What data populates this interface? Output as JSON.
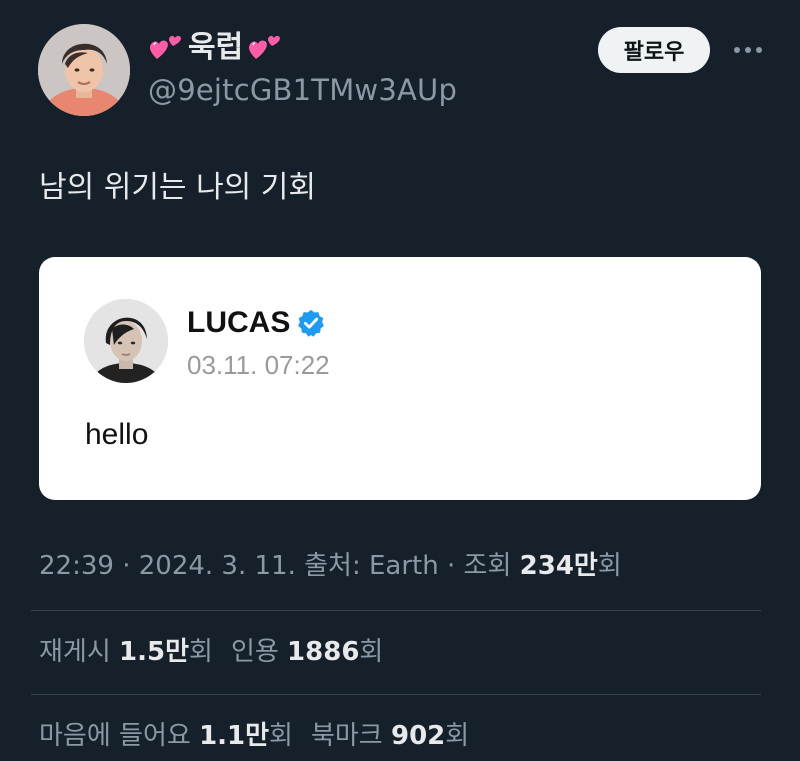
{
  "author": {
    "display_name": "욱럽",
    "handle": "@9ejtcGB1TMw3AUp",
    "name_decoration_icon": "two-hearts-icon"
  },
  "actions": {
    "follow_label": "팔로우",
    "more_icon": "more-dots-icon"
  },
  "tweet": {
    "text": "남의 위기는 나의 기회"
  },
  "quoted_card": {
    "name": "LUCAS",
    "verified_icon": "verified-badge-icon",
    "verified_color": "#1d9bf0",
    "time": "03.11. 07:22",
    "body": "hello"
  },
  "meta": {
    "time": "22:39",
    "sep1": " · ",
    "date": "2024. 3. 11.",
    "source_label": " 출처: ",
    "source": "Earth",
    "sep2": " · ",
    "views_label": "조회 ",
    "views_value": "234만",
    "views_suffix": "회"
  },
  "stats_row1": {
    "reposts_label": "재게시 ",
    "reposts_value": "1.5만",
    "reposts_suffix": "회",
    "quotes_label": "인용 ",
    "quotes_value": "1886",
    "quotes_suffix": "회"
  },
  "stats_row2": {
    "likes_label": "마음에 들어요 ",
    "likes_value": "1.1만",
    "likes_suffix": "회",
    "bookmarks_label": "북마크 ",
    "bookmarks_value": "902",
    "bookmarks_suffix": "회"
  },
  "colors": {
    "background": "#15202b",
    "primary_text": "#e7e9ea",
    "secondary_text": "#8b98a5",
    "heart_pink": "#ff5ca8"
  }
}
